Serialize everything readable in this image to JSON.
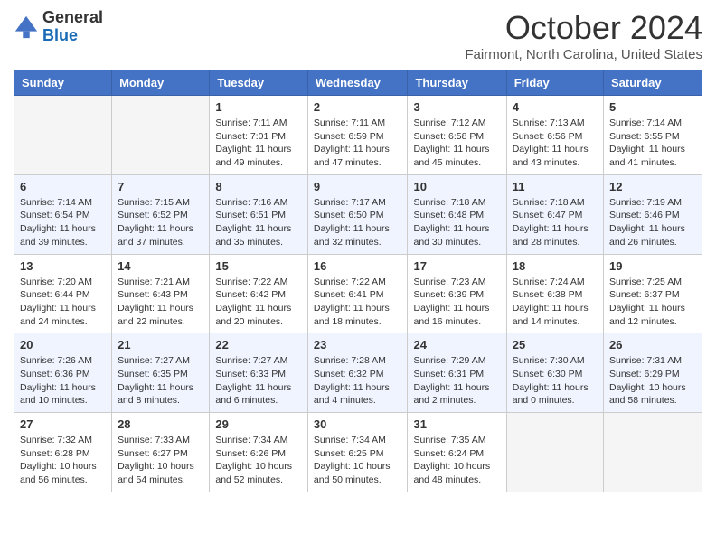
{
  "header": {
    "logo_general": "General",
    "logo_blue": "Blue",
    "month_title": "October 2024",
    "location": "Fairmont, North Carolina, United States"
  },
  "days_of_week": [
    "Sunday",
    "Monday",
    "Tuesday",
    "Wednesday",
    "Thursday",
    "Friday",
    "Saturday"
  ],
  "weeks": [
    [
      {
        "day": "",
        "sunrise": "",
        "sunset": "",
        "daylight": ""
      },
      {
        "day": "",
        "sunrise": "",
        "sunset": "",
        "daylight": ""
      },
      {
        "day": "1",
        "sunrise": "Sunrise: 7:11 AM",
        "sunset": "Sunset: 7:01 PM",
        "daylight": "Daylight: 11 hours and 49 minutes."
      },
      {
        "day": "2",
        "sunrise": "Sunrise: 7:11 AM",
        "sunset": "Sunset: 6:59 PM",
        "daylight": "Daylight: 11 hours and 47 minutes."
      },
      {
        "day": "3",
        "sunrise": "Sunrise: 7:12 AM",
        "sunset": "Sunset: 6:58 PM",
        "daylight": "Daylight: 11 hours and 45 minutes."
      },
      {
        "day": "4",
        "sunrise": "Sunrise: 7:13 AM",
        "sunset": "Sunset: 6:56 PM",
        "daylight": "Daylight: 11 hours and 43 minutes."
      },
      {
        "day": "5",
        "sunrise": "Sunrise: 7:14 AM",
        "sunset": "Sunset: 6:55 PM",
        "daylight": "Daylight: 11 hours and 41 minutes."
      }
    ],
    [
      {
        "day": "6",
        "sunrise": "Sunrise: 7:14 AM",
        "sunset": "Sunset: 6:54 PM",
        "daylight": "Daylight: 11 hours and 39 minutes."
      },
      {
        "day": "7",
        "sunrise": "Sunrise: 7:15 AM",
        "sunset": "Sunset: 6:52 PM",
        "daylight": "Daylight: 11 hours and 37 minutes."
      },
      {
        "day": "8",
        "sunrise": "Sunrise: 7:16 AM",
        "sunset": "Sunset: 6:51 PM",
        "daylight": "Daylight: 11 hours and 35 minutes."
      },
      {
        "day": "9",
        "sunrise": "Sunrise: 7:17 AM",
        "sunset": "Sunset: 6:50 PM",
        "daylight": "Daylight: 11 hours and 32 minutes."
      },
      {
        "day": "10",
        "sunrise": "Sunrise: 7:18 AM",
        "sunset": "Sunset: 6:48 PM",
        "daylight": "Daylight: 11 hours and 30 minutes."
      },
      {
        "day": "11",
        "sunrise": "Sunrise: 7:18 AM",
        "sunset": "Sunset: 6:47 PM",
        "daylight": "Daylight: 11 hours and 28 minutes."
      },
      {
        "day": "12",
        "sunrise": "Sunrise: 7:19 AM",
        "sunset": "Sunset: 6:46 PM",
        "daylight": "Daylight: 11 hours and 26 minutes."
      }
    ],
    [
      {
        "day": "13",
        "sunrise": "Sunrise: 7:20 AM",
        "sunset": "Sunset: 6:44 PM",
        "daylight": "Daylight: 11 hours and 24 minutes."
      },
      {
        "day": "14",
        "sunrise": "Sunrise: 7:21 AM",
        "sunset": "Sunset: 6:43 PM",
        "daylight": "Daylight: 11 hours and 22 minutes."
      },
      {
        "day": "15",
        "sunrise": "Sunrise: 7:22 AM",
        "sunset": "Sunset: 6:42 PM",
        "daylight": "Daylight: 11 hours and 20 minutes."
      },
      {
        "day": "16",
        "sunrise": "Sunrise: 7:22 AM",
        "sunset": "Sunset: 6:41 PM",
        "daylight": "Daylight: 11 hours and 18 minutes."
      },
      {
        "day": "17",
        "sunrise": "Sunrise: 7:23 AM",
        "sunset": "Sunset: 6:39 PM",
        "daylight": "Daylight: 11 hours and 16 minutes."
      },
      {
        "day": "18",
        "sunrise": "Sunrise: 7:24 AM",
        "sunset": "Sunset: 6:38 PM",
        "daylight": "Daylight: 11 hours and 14 minutes."
      },
      {
        "day": "19",
        "sunrise": "Sunrise: 7:25 AM",
        "sunset": "Sunset: 6:37 PM",
        "daylight": "Daylight: 11 hours and 12 minutes."
      }
    ],
    [
      {
        "day": "20",
        "sunrise": "Sunrise: 7:26 AM",
        "sunset": "Sunset: 6:36 PM",
        "daylight": "Daylight: 11 hours and 10 minutes."
      },
      {
        "day": "21",
        "sunrise": "Sunrise: 7:27 AM",
        "sunset": "Sunset: 6:35 PM",
        "daylight": "Daylight: 11 hours and 8 minutes."
      },
      {
        "day": "22",
        "sunrise": "Sunrise: 7:27 AM",
        "sunset": "Sunset: 6:33 PM",
        "daylight": "Daylight: 11 hours and 6 minutes."
      },
      {
        "day": "23",
        "sunrise": "Sunrise: 7:28 AM",
        "sunset": "Sunset: 6:32 PM",
        "daylight": "Daylight: 11 hours and 4 minutes."
      },
      {
        "day": "24",
        "sunrise": "Sunrise: 7:29 AM",
        "sunset": "Sunset: 6:31 PM",
        "daylight": "Daylight: 11 hours and 2 minutes."
      },
      {
        "day": "25",
        "sunrise": "Sunrise: 7:30 AM",
        "sunset": "Sunset: 6:30 PM",
        "daylight": "Daylight: 11 hours and 0 minutes."
      },
      {
        "day": "26",
        "sunrise": "Sunrise: 7:31 AM",
        "sunset": "Sunset: 6:29 PM",
        "daylight": "Daylight: 10 hours and 58 minutes."
      }
    ],
    [
      {
        "day": "27",
        "sunrise": "Sunrise: 7:32 AM",
        "sunset": "Sunset: 6:28 PM",
        "daylight": "Daylight: 10 hours and 56 minutes."
      },
      {
        "day": "28",
        "sunrise": "Sunrise: 7:33 AM",
        "sunset": "Sunset: 6:27 PM",
        "daylight": "Daylight: 10 hours and 54 minutes."
      },
      {
        "day": "29",
        "sunrise": "Sunrise: 7:34 AM",
        "sunset": "Sunset: 6:26 PM",
        "daylight": "Daylight: 10 hours and 52 minutes."
      },
      {
        "day": "30",
        "sunrise": "Sunrise: 7:34 AM",
        "sunset": "Sunset: 6:25 PM",
        "daylight": "Daylight: 10 hours and 50 minutes."
      },
      {
        "day": "31",
        "sunrise": "Sunrise: 7:35 AM",
        "sunset": "Sunset: 6:24 PM",
        "daylight": "Daylight: 10 hours and 48 minutes."
      },
      {
        "day": "",
        "sunrise": "",
        "sunset": "",
        "daylight": ""
      },
      {
        "day": "",
        "sunrise": "",
        "sunset": "",
        "daylight": ""
      }
    ]
  ]
}
